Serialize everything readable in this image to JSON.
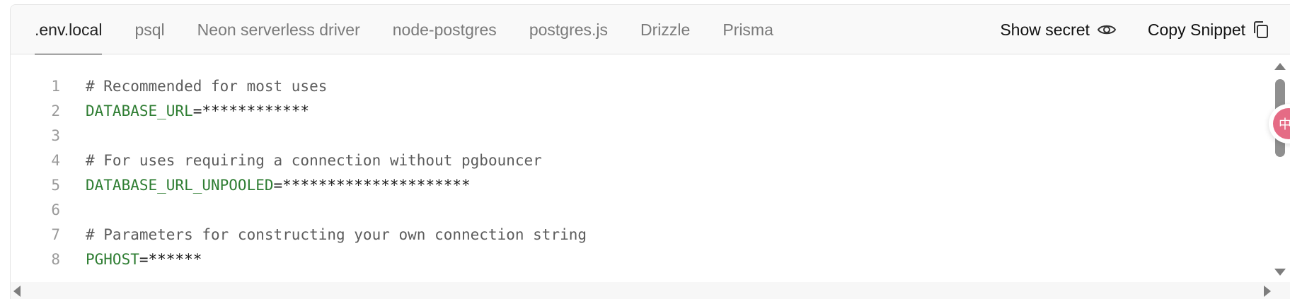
{
  "tabs": [
    {
      "label": ".env.local",
      "active": true
    },
    {
      "label": "psql",
      "active": false
    },
    {
      "label": "Neon serverless driver",
      "active": false
    },
    {
      "label": "node-postgres",
      "active": false
    },
    {
      "label": "postgres.js",
      "active": false
    },
    {
      "label": "Drizzle",
      "active": false
    },
    {
      "label": "Prisma",
      "active": false
    }
  ],
  "actions": {
    "show_secret": {
      "label": "Show secret",
      "icon": "eye-icon"
    },
    "copy_snippet": {
      "label": "Copy Snippet",
      "icon": "copy-icon"
    }
  },
  "code": {
    "lines": [
      {
        "number": "1",
        "comment": "# Recommended for most uses"
      },
      {
        "number": "2",
        "key": "DATABASE_URL",
        "value": "=************"
      },
      {
        "number": "3"
      },
      {
        "number": "4",
        "comment": "# For uses requiring a connection without pgbouncer"
      },
      {
        "number": "5",
        "key": "DATABASE_URL_UNPOOLED",
        "value": "=*********************"
      },
      {
        "number": "6"
      },
      {
        "number": "7",
        "comment": "# Parameters for constructing your own connection string"
      },
      {
        "number": "8",
        "key": "PGHOST",
        "value": "=******"
      }
    ]
  },
  "floating_badge": {
    "icon": "translate-badge-icon",
    "glyph": "中"
  },
  "colors": {
    "key": "#2e7d32",
    "comment": "#5c5c5c",
    "line_number": "#9a9a9a",
    "active_tab_underline": "#1b1b1b",
    "badge": "#e56b85"
  }
}
